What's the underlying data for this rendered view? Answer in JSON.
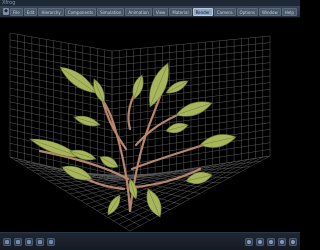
{
  "window": {
    "title": "Xfrog"
  },
  "menubar": {
    "app_icon": "app-icon",
    "items": [
      {
        "label": "File",
        "active": false
      },
      {
        "label": "Edit",
        "active": false
      },
      {
        "label": "Hierarchy",
        "active": false
      },
      {
        "label": "Components",
        "active": false
      },
      {
        "label": "Simulation",
        "active": false
      },
      {
        "label": "Animation",
        "active": false
      },
      {
        "label": "View",
        "active": false
      },
      {
        "label": "Material",
        "active": false
      },
      {
        "label": "Render",
        "active": true
      },
      {
        "label": "Camera",
        "active": false
      },
      {
        "label": "Options",
        "active": false
      },
      {
        "label": "Window",
        "active": false
      },
      {
        "label": "Help",
        "active": false
      }
    ]
  },
  "viewport": {
    "grid_color": "#5a5a5a",
    "stem_color": "#b8866c",
    "leaf_color": "#a7b55c",
    "leaf_shade": "#6f7a33"
  },
  "statusbar": {
    "left_buttons": [
      "move-icon",
      "rotate-icon",
      "zoom-icon",
      "pan-icon",
      "fit-icon"
    ],
    "right_buttons": [
      "light-icon",
      "camera-icon",
      "render-icon",
      "settings-icon",
      "close-icon"
    ]
  }
}
